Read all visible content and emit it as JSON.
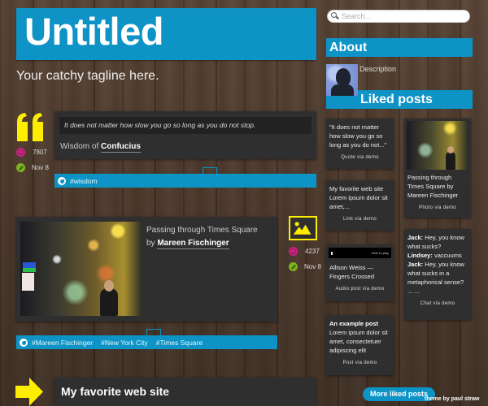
{
  "header": {
    "title": "Untitled",
    "tagline": "Your catchy tagline here."
  },
  "posts": [
    {
      "type": "quote",
      "icon": "quote-icon",
      "quote": "It does not matter how slow you go so long as you do not stop.",
      "source_prefix": "Wisdom of",
      "source_name": "Confucius",
      "notes": "7807",
      "date": "Nov 8",
      "tags": [
        "#wisdom"
      ]
    },
    {
      "type": "photo",
      "icon": "image-icon",
      "caption_title": "Passing through Times Square",
      "caption_by": "by",
      "caption_author": "Mareen Fischinger",
      "notes": "4237",
      "date": "Nov 8",
      "tags": [
        "#Mareen Fischinger",
        "#New York City",
        "#Times Square"
      ]
    },
    {
      "type": "link",
      "icon": "arrow-right-icon",
      "title": "My favorite web site"
    }
  ],
  "sidebar": {
    "search_placeholder": "Search...",
    "about_heading": "About",
    "description": "Description",
    "liked_heading": "Liked posts",
    "liked_posts": [
      {
        "text": "\"It does not matter how slow you go so long as you do not...\"",
        "via": "Quote via demo"
      },
      {
        "text": "My favorite web site Lorem ipsum dolor sit amet,...",
        "via": "Link via demo"
      },
      {
        "player_label": "Click to play",
        "text": "Allison Weiss — Fingers Crossed",
        "via": "Audio post via demo"
      },
      {
        "title": "An example post",
        "text": "Lorem ipsum dolor sit amet, consectetuer adipiscing elit",
        "via": "Post via demo"
      },
      {
        "text": "Passing through Times Square by Mareen Fischinger",
        "via": "Photo via demo"
      },
      {
        "chat": [
          {
            "speaker": "Jack:",
            "line": "Hey, you know what sucks?"
          },
          {
            "speaker": "Lindsey:",
            "line": "vaccuums"
          },
          {
            "speaker": "Jack:",
            "line": "Hey, you know what sucks in a metaphorical sense?"
          }
        ],
        "ellipsis": "... ...",
        "via": "Chat via demo"
      }
    ],
    "more_button": "More liked posts"
  },
  "footer": {
    "credit": "theme by paul straw"
  },
  "colors": {
    "accent_blue": "#0d93c6",
    "icon_yellow": "#ffed00",
    "notes_pink": "#d91b8c",
    "permalink_green": "#7bb41d",
    "post_bg": "#2f2f2f"
  }
}
